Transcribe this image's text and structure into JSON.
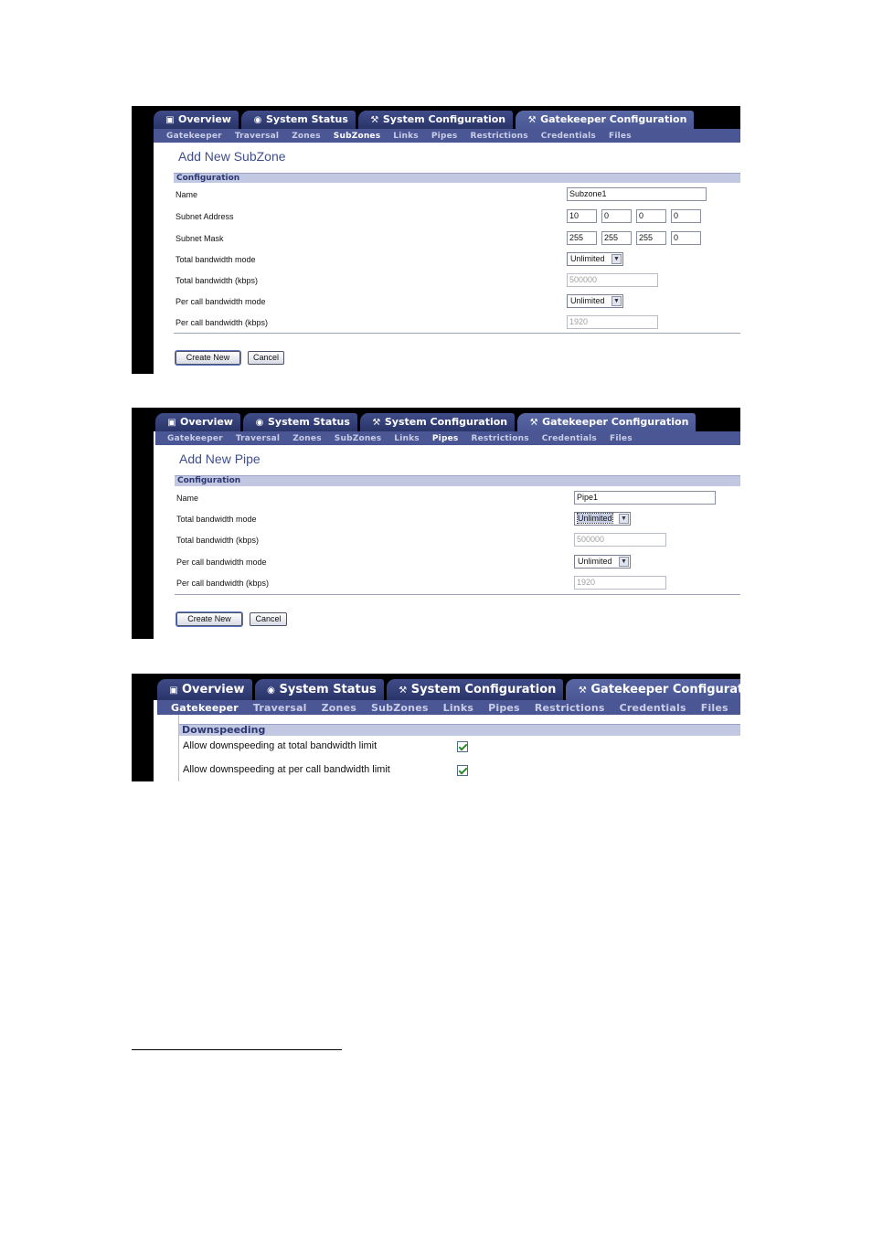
{
  "tabs": [
    {
      "label": "Overview",
      "icon": "overview-icon",
      "glyph": "▣"
    },
    {
      "label": "System Status",
      "icon": "status-icon",
      "glyph": "◉"
    },
    {
      "label": "System Configuration",
      "icon": "wrench-icon",
      "glyph": "⚒"
    },
    {
      "label": "Gatekeeper Configuration",
      "icon": "wrench-icon",
      "glyph": "⚒"
    }
  ],
  "subnav": [
    "Gatekeeper",
    "Traversal",
    "Zones",
    "SubZones",
    "Links",
    "Pipes",
    "Restrictions",
    "Credentials",
    "Files"
  ],
  "colors": {
    "accent": "#4b5794",
    "title": "#3f4e8c",
    "section": "#c3c8e2"
  },
  "subzone": {
    "title": "Add New SubZone",
    "section": "Configuration",
    "labels": {
      "name": "Name",
      "subnet_address": "Subnet Address",
      "subnet_mask": "Subnet Mask",
      "total_mode": "Total bandwidth mode",
      "total_bw": "Total bandwidth (kbps)",
      "percall_mode": "Per call bandwidth mode",
      "percall_bw": "Per call bandwidth (kbps)"
    },
    "values": {
      "name": "Subzone1",
      "addr": [
        "10",
        "0",
        "0",
        "0"
      ],
      "mask": [
        "255",
        "255",
        "255",
        "0"
      ],
      "total_mode": "Unlimited",
      "total_bw": "500000",
      "percall_mode": "Unlimited",
      "percall_bw": "1920"
    },
    "buttons": {
      "create": "Create New",
      "cancel": "Cancel"
    }
  },
  "pipe": {
    "title": "Add New Pipe",
    "section": "Configuration",
    "labels": {
      "name": "Name",
      "total_mode": "Total bandwidth mode",
      "total_bw": "Total bandwidth (kbps)",
      "percall_mode": "Per call bandwidth mode",
      "percall_bw": "Per call bandwidth (kbps)"
    },
    "values": {
      "name": "Pipe1",
      "total_mode": "Unlimited",
      "total_bw": "500000",
      "percall_mode": "Unlimited",
      "percall_bw": "1920"
    },
    "buttons": {
      "create": "Create New",
      "cancel": "Cancel"
    }
  },
  "downspeed": {
    "section": "Downspeeding",
    "items": [
      {
        "label": "Allow downspeeding at total bandwidth limit",
        "checked": true
      },
      {
        "label": "Allow downspeeding at per call bandwidth limit",
        "checked": true
      }
    ]
  }
}
